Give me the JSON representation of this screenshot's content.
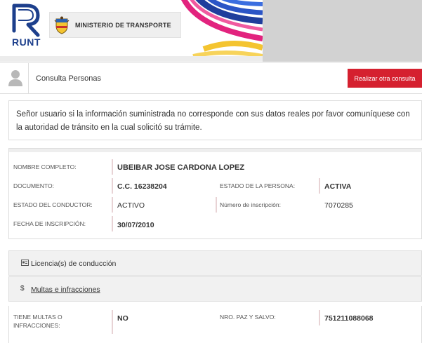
{
  "banner": {
    "logo_text": "RUNT",
    "ministry": "MINISTERIO DE TRANSPORTE"
  },
  "header": {
    "title": "Consulta Personas",
    "action_button": "Realizar otra consulta"
  },
  "notice": {
    "text": "Señor usuario si la información suministrada no corresponde con sus datos reales por favor comuníquese con la autoridad de tránsito en la cual solicitó su trámite."
  },
  "person": {
    "nombre_label": "NOMBRE COMPLETO:",
    "nombre_value": "UBEIBAR JOSE CARDONA LOPEZ",
    "documento_label": "DOCUMENTO:",
    "documento_value": "C.C. 16238204",
    "estado_persona_label": "ESTADO DE LA PERSONA:",
    "estado_persona_value": "ACTIVA",
    "estado_conductor_label": "ESTADO DEL CONDUCTOR:",
    "estado_conductor_value": "ACTIVO",
    "numero_inscripcion_label": "Número de inscripción:",
    "numero_inscripcion_value": "7070285",
    "fecha_inscripcion_label": "FECHA DE INSCRIPCIÓN:",
    "fecha_inscripcion_value": "30/07/2010"
  },
  "sections": {
    "licencias": "Licencia(s) de conducción",
    "multas": "Multas e infracciones",
    "multas_icon": "$"
  },
  "fines": {
    "tiene_multas_label_1": "TIENE MULTAS O",
    "tiene_multas_label_2": "INFRACCIONES:",
    "tiene_multas_value": "NO",
    "paz_salvo_label": "NRO. PAZ Y SALVO:",
    "paz_salvo_value": "751211088068"
  },
  "icons": {
    "logo": "runt-logo-icon",
    "shield": "colombia-shield-icon",
    "user": "user-icon",
    "license": "id-card-icon"
  },
  "colors": {
    "brand_blue": "#1d3f8c",
    "accent_red": "#d5202f",
    "label_bar": "#e8d3d5"
  }
}
